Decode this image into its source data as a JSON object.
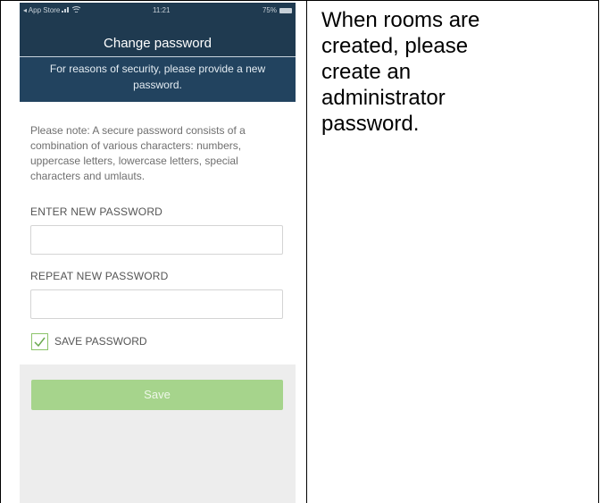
{
  "status_bar": {
    "carrier": "◂ App Store",
    "time": "11:21",
    "battery_percent": "75%"
  },
  "nav": {
    "title": "Change password"
  },
  "banner": {
    "text": "For reasons of security, please provide a new password."
  },
  "note": {
    "text": "Please note: A secure password consists of a combination of various characters: numbers, uppercase letters, lowercase letters, special characters and umlauts."
  },
  "form": {
    "new_password_label": "ENTER NEW PASSWORD",
    "new_password_value": "",
    "repeat_password_label": "REPEAT NEW PASSWORD",
    "repeat_password_value": "",
    "save_password_label": "SAVE PASSWORD",
    "save_password_checked": true,
    "save_button_label": "Save"
  },
  "caption": {
    "lines": [
      "When rooms are",
      "created, please",
      "create an",
      "administrator",
      "password."
    ]
  },
  "colors": {
    "header_bg": "#1f3a50",
    "banner_bg": "#22435f",
    "accent_green": "#a6d48c",
    "check_green": "#8cc46a"
  }
}
